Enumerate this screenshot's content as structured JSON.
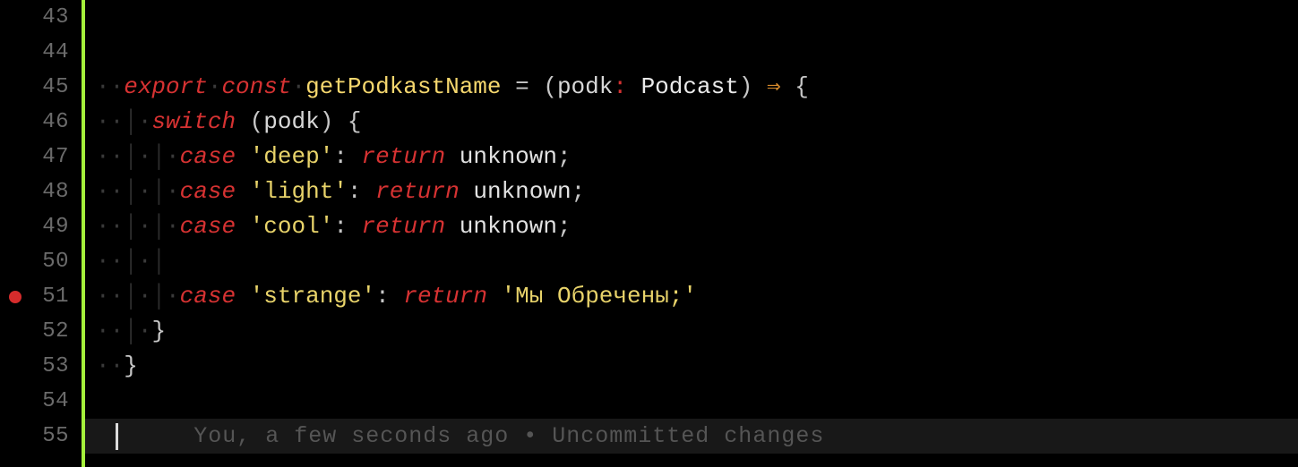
{
  "lines": {
    "43": "43",
    "44": "44",
    "45": "45",
    "46": "46",
    "47": "47",
    "48": "48",
    "49": "49",
    "50": "50",
    "51": "51",
    "52": "52",
    "53": "53",
    "54": "54",
    "55": "55"
  },
  "code": {
    "l45": {
      "export": "export",
      "const": "const",
      "fn": "getPodkastName",
      "eq": " = ",
      "lp": "(",
      "param": "podk",
      "colon": ":",
      "sp": " ",
      "type": "Podcast",
      "rp": ")",
      "sp2": " ",
      "arrow": "⇒",
      "sp3": " ",
      "lb": "{"
    },
    "l46": {
      "switch": "switch",
      "sp": " ",
      "lp": "(",
      "param": "podk",
      "rp": ")",
      "sp2": " ",
      "lb": "{"
    },
    "l47": {
      "case": "case",
      "sp": " ",
      "str": "'deep'",
      "colon": ":",
      "sp2": " ",
      "return": "return",
      "sp3": " ",
      "ident": "unknown",
      "semi": ";"
    },
    "l48": {
      "case": "case",
      "sp": " ",
      "str": "'light'",
      "colon": ":",
      "sp2": " ",
      "return": "return",
      "sp3": " ",
      "ident": "unknown",
      "semi": ";"
    },
    "l49": {
      "case": "case",
      "sp": " ",
      "str": "'cool'",
      "colon": ":",
      "sp2": " ",
      "return": "return",
      "sp3": " ",
      "ident": "unknown",
      "semi": ";"
    },
    "l51": {
      "case": "case",
      "sp": " ",
      "str": "'strange'",
      "colon": ":",
      "sp2": " ",
      "return": "return",
      "sp3": " ",
      "str2": "'Мы Обречены;'"
    },
    "l52": {
      "rb": "}"
    },
    "l53": {
      "rb": "}"
    }
  },
  "blame": {
    "text": "You, a few seconds ago • Uncommitted changes"
  },
  "ws": {
    "dot": "·",
    "pipe": "│"
  }
}
